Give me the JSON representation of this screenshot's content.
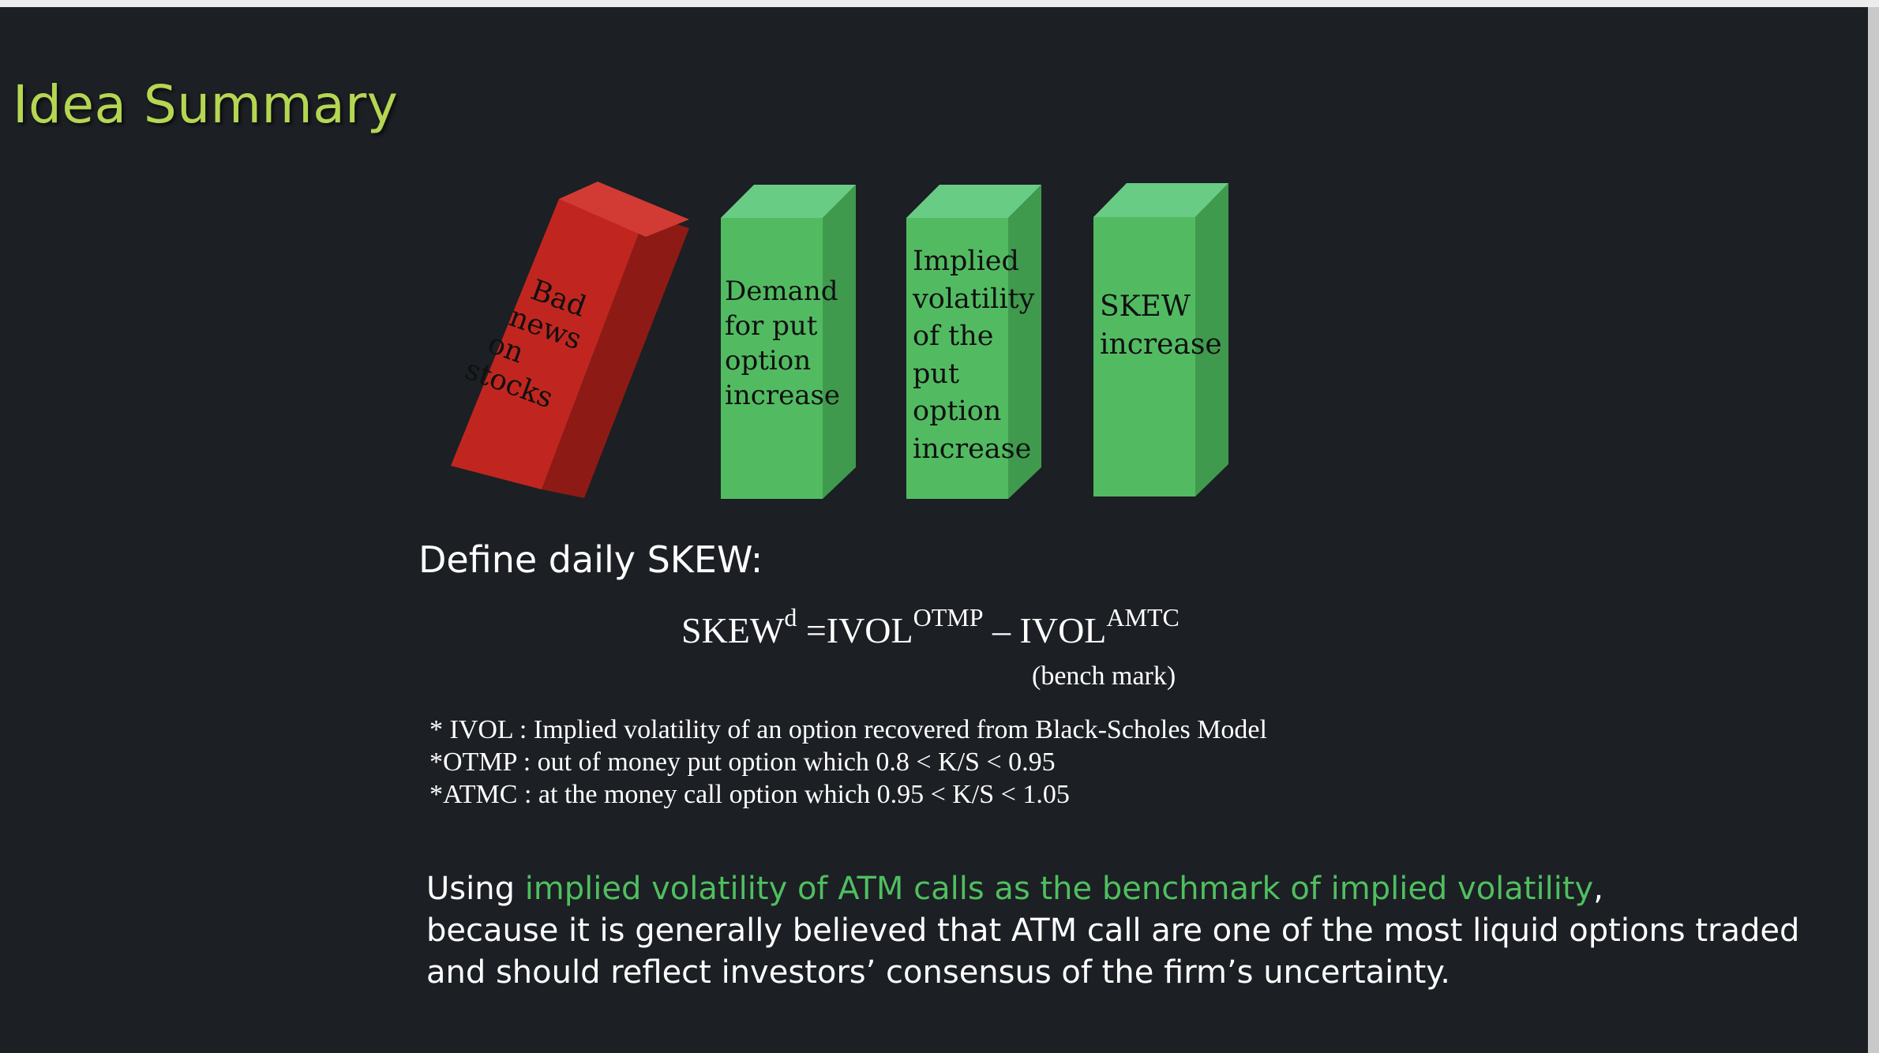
{
  "slide": {
    "title": "Idea Summary"
  },
  "blocks": [
    {
      "label": [
        "Bad",
        "news",
        "on",
        "stocks"
      ],
      "color": "#c0261f"
    },
    {
      "label": [
        "Demand",
        "for put",
        "option",
        "increase"
      ],
      "color": "#52bb62"
    },
    {
      "label": [
        "Implied",
        "volatility",
        "of the",
        "put",
        "option",
        "increase"
      ],
      "color": "#52bb62"
    },
    {
      "label": [
        "SKEW",
        "increase"
      ],
      "color": "#52bb62"
    }
  ],
  "define": {
    "heading": "Define daily SKEW:",
    "formula": {
      "lhs": "SKEW",
      "lhs_sup": "d",
      "eq": " =IVOL",
      "sup1": "OTMP",
      "minus": " – IVOL",
      "sup2": "AMTC"
    },
    "bench_note": "(bench mark)"
  },
  "notes": [
    "* IVOL : Implied volatility of an option recovered from Black-Scholes Model",
    "*OTMP : out of money put option which 0.8 < K/S < 0.95",
    "*ATMC : at the money call option which 0.95 < K/S < 1.05"
  ],
  "paragraph": {
    "prefix": "Using ",
    "highlight": "implied volatility of ATM calls as the benchmark of implied volatility",
    "rest_line1": ",",
    "rest": "because it is generally believed that ATM call are one of the most liquid options traded and should reflect investors’ consensus of the firm’s uncertainty."
  },
  "colors": {
    "background": "#1c1f24",
    "title": "#b5d652",
    "highlight": "#4fbf5f",
    "red_block": "#c0261f",
    "green_block": "#52bb62"
  }
}
